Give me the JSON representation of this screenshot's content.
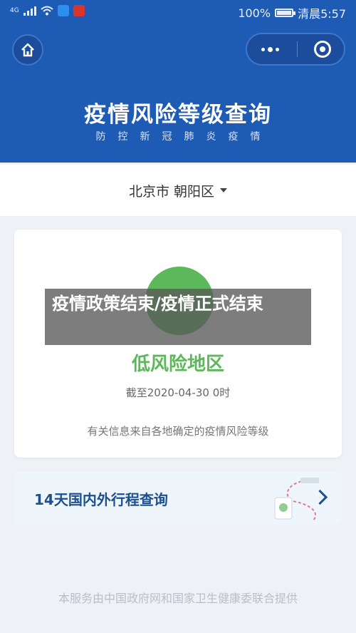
{
  "status_bar": {
    "network": "4G",
    "battery_percent": "100%",
    "time": "清晨5:57"
  },
  "header": {
    "title": "疫情风险等级查询",
    "subtitle": "防控新冠肺炎疫情"
  },
  "region": {
    "selected": "北京市 朝阳区"
  },
  "result": {
    "risk_level": "低风险地区",
    "as_of": "截至2020-04-30 0时",
    "note": "有关信息来自各地确定的疫情风险等级"
  },
  "travel_query": {
    "label": "14天国内外行程查询"
  },
  "footer": {
    "text": "本服务由中国政府网和国家卫生健康委联合提供"
  },
  "overlay": {
    "text": "疫情政策结束/疫情正式结束"
  },
  "colors": {
    "header_bg": "#1e5bb5",
    "low_risk_green": "#5cb85a",
    "travel_text": "#1e4f8f"
  }
}
